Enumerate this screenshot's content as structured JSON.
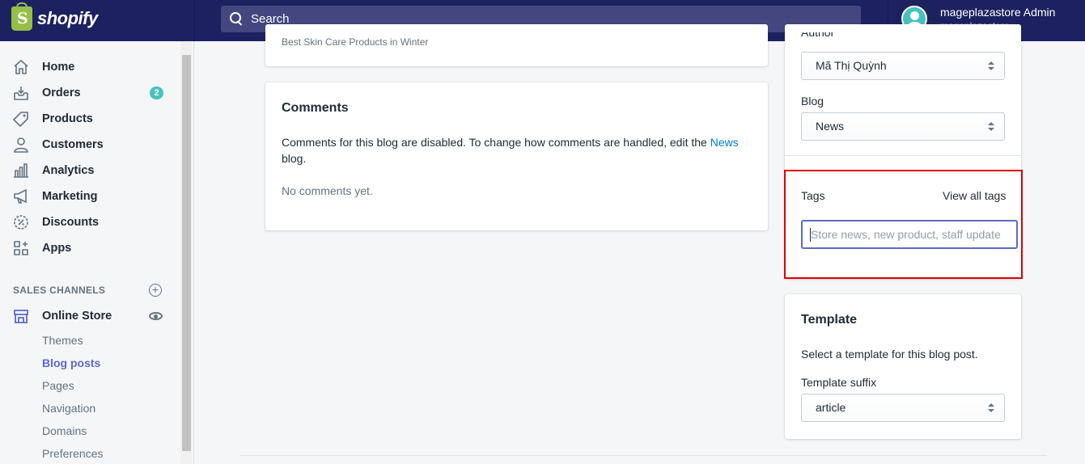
{
  "topbar": {
    "logo_text": "shopify",
    "search_placeholder": "Search",
    "user_name": "mageplazastore Admin",
    "user_store": "mageplazastore"
  },
  "sidebar": {
    "items": [
      {
        "label": "Home",
        "icon": "home-icon"
      },
      {
        "label": "Orders",
        "icon": "orders-icon",
        "badge": "2"
      },
      {
        "label": "Products",
        "icon": "tag-icon"
      },
      {
        "label": "Customers",
        "icon": "person-icon"
      },
      {
        "label": "Analytics",
        "icon": "bar-chart-icon"
      },
      {
        "label": "Marketing",
        "icon": "megaphone-icon"
      },
      {
        "label": "Discounts",
        "icon": "discount-icon"
      },
      {
        "label": "Apps",
        "icon": "apps-icon"
      }
    ],
    "sales_channels_title": "SALES CHANNELS",
    "online_store": "Online Store",
    "sub_items": [
      "Themes",
      "Blog posts",
      "Pages",
      "Navigation",
      "Domains",
      "Preferences"
    ],
    "active_sub_item": "Blog posts"
  },
  "main": {
    "excerpt_partial": "Best Skin Care Products in Winter",
    "comments": {
      "title": "Comments",
      "text_before_link": "Comments for this blog are disabled. To change how comments are handled, edit the ",
      "link": "News",
      "text_after_link": "blog.",
      "empty": "No comments yet."
    }
  },
  "right": {
    "author_label": "Author",
    "author_value": "Mã Thị Quỳnh",
    "blog_label": "Blog",
    "blog_value": "News",
    "tags_label": "Tags",
    "view_all_tags": "View all tags",
    "tags_placeholder": "Store news, new product, staff update",
    "template": {
      "title": "Template",
      "description": "Select a template for this blog post.",
      "suffix_label": "Template suffix",
      "suffix_value": "article"
    }
  },
  "colors": {
    "topbar": "#1c2260",
    "accent": "#5c6ac4",
    "link": "#007ace",
    "badge": "#47c1bf",
    "highlight": "#e00000"
  }
}
